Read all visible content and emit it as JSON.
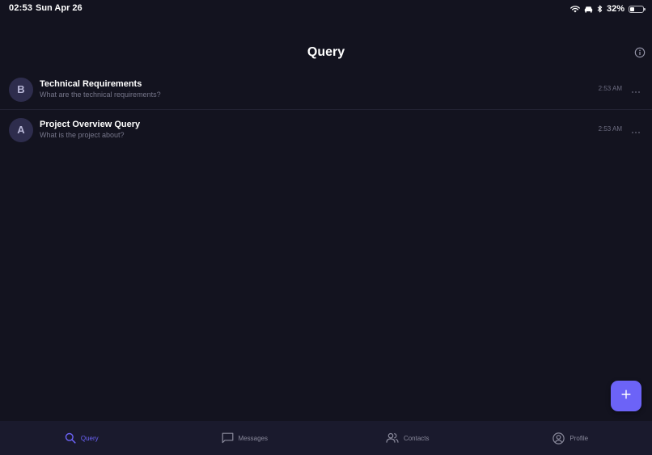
{
  "status_bar": {
    "time": "02:53",
    "date": "Sun Apr 26",
    "battery_percent": "32%",
    "battery_level": 0.32,
    "icons": [
      "wifi-icon",
      "car-icon",
      "bluetooth-icon",
      "battery-icon"
    ]
  },
  "header": {
    "title": "Query",
    "info_icon": "info-icon"
  },
  "queries": [
    {
      "avatar_letter": "B",
      "title": "Technical Requirements",
      "subtitle": "What are the technical requirements?",
      "time": "2:53 AM"
    },
    {
      "avatar_letter": "A",
      "title": "Project Overview Query",
      "subtitle": "What is the project about?",
      "time": "2:53 AM"
    }
  ],
  "fab": {
    "icon": "plus-icon"
  },
  "bottom_nav": {
    "items": [
      {
        "label": "Query",
        "icon": "search-icon",
        "active": true
      },
      {
        "label": "Messages",
        "icon": "message-icon",
        "active": false
      },
      {
        "label": "Contacts",
        "icon": "contacts-icon",
        "active": false
      },
      {
        "label": "Profile",
        "icon": "profile-icon",
        "active": false
      }
    ]
  },
  "colors": {
    "background": "#13131f",
    "nav_background": "#1a1a2d",
    "accent": "#6c63f7",
    "avatar_background": "#2e2d4d",
    "muted_text": "#76768a"
  }
}
